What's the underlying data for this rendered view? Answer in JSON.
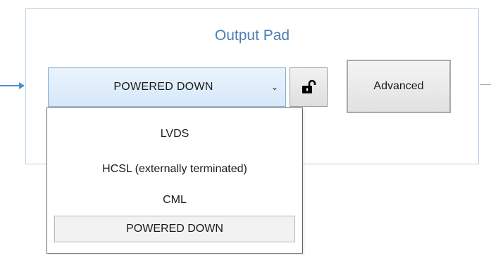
{
  "panel": {
    "title": "Output Pad"
  },
  "mode_select": {
    "value": "POWERED DOWN",
    "options": [
      "LVDS",
      "HCSL (externally terminated)",
      "CML",
      "POWERED DOWN"
    ],
    "selected_index": 3
  },
  "lock_button": {
    "icon": "unlocked-padlock-icon",
    "state": "unlocked"
  },
  "advanced_button": {
    "label": "Advanced"
  },
  "colors": {
    "panel_border": "#b9cfe6",
    "title_text": "#4a7fb3",
    "connector": "#4a8fd0",
    "select_border": "#7fb0d8",
    "select_fill": "#dbeafb"
  }
}
